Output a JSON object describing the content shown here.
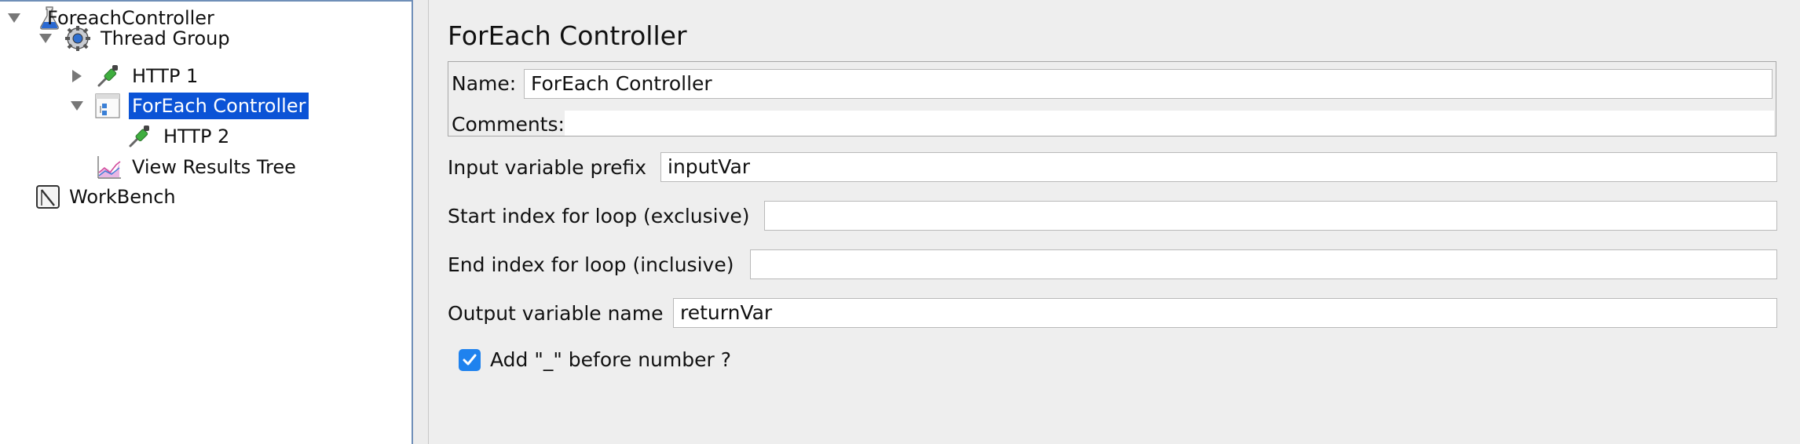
{
  "tree": {
    "nodes": [
      {
        "label": "ForeachController",
        "icon": "flask-icon",
        "expanded": true
      },
      {
        "label": "Thread Group",
        "icon": "gear-icon",
        "expanded": true
      },
      {
        "label": "HTTP 1",
        "icon": "pipette-icon",
        "expanded": false
      },
      {
        "label": "ForEach Controller",
        "icon": "controller-icon",
        "expanded": true,
        "selected": true
      },
      {
        "label": "HTTP 2",
        "icon": "pipette-icon"
      },
      {
        "label": "View Results Tree",
        "icon": "graph-icon"
      },
      {
        "label": "WorkBench",
        "icon": "workbench-icon"
      }
    ]
  },
  "panel": {
    "title": "ForEach Controller",
    "name_label": "Name:",
    "name_value": "ForEach Controller",
    "comments_label": "Comments:",
    "comments_value": "",
    "input_prefix_label": "Input variable prefix",
    "input_prefix_value": "inputVar",
    "start_index_label": "Start index for loop (exclusive)",
    "start_index_value": "",
    "end_index_label": "End index for loop (inclusive)",
    "end_index_value": "",
    "output_name_label": "Output variable name",
    "output_name_value": "returnVar",
    "checkbox_label": "Add \"_\" before number ?",
    "checkbox_checked": true
  },
  "colors": {
    "selection": "#0b53d6",
    "checkbox": "#1f82ee",
    "panel_bg": "#eeeeee",
    "tree_border": "#6f8fb8"
  }
}
